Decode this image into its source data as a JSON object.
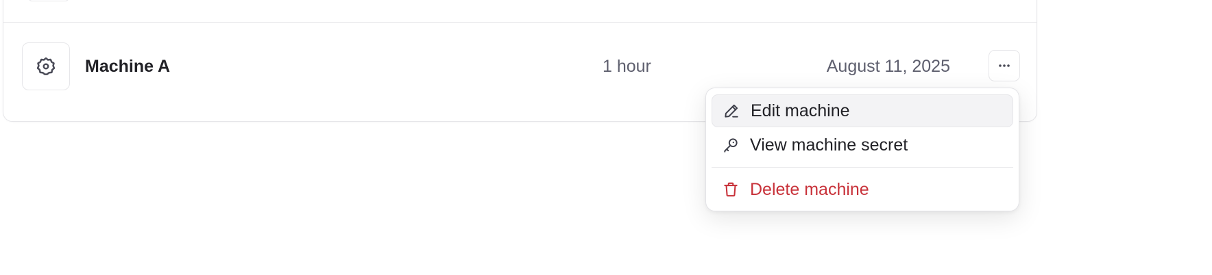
{
  "machine_row": {
    "name": "Machine A",
    "token_ttl": "1 hour",
    "created_date": "August 11, 2025",
    "icon": "gear-icon",
    "more_icon": "ellipsis-icon"
  },
  "menu": {
    "items": [
      {
        "label": "Edit machine",
        "icon": "pencil-icon",
        "state": "highlighted"
      },
      {
        "label": "View machine secret",
        "icon": "key-icon"
      }
    ],
    "danger_item": {
      "label": "Delete machine",
      "icon": "trash-icon"
    }
  },
  "colors": {
    "text_primary": "#212126",
    "text_secondary": "#5e5f6e",
    "danger": "#c8323a",
    "border": "#e6e6e9",
    "hover_bg": "#f3f3f5"
  }
}
